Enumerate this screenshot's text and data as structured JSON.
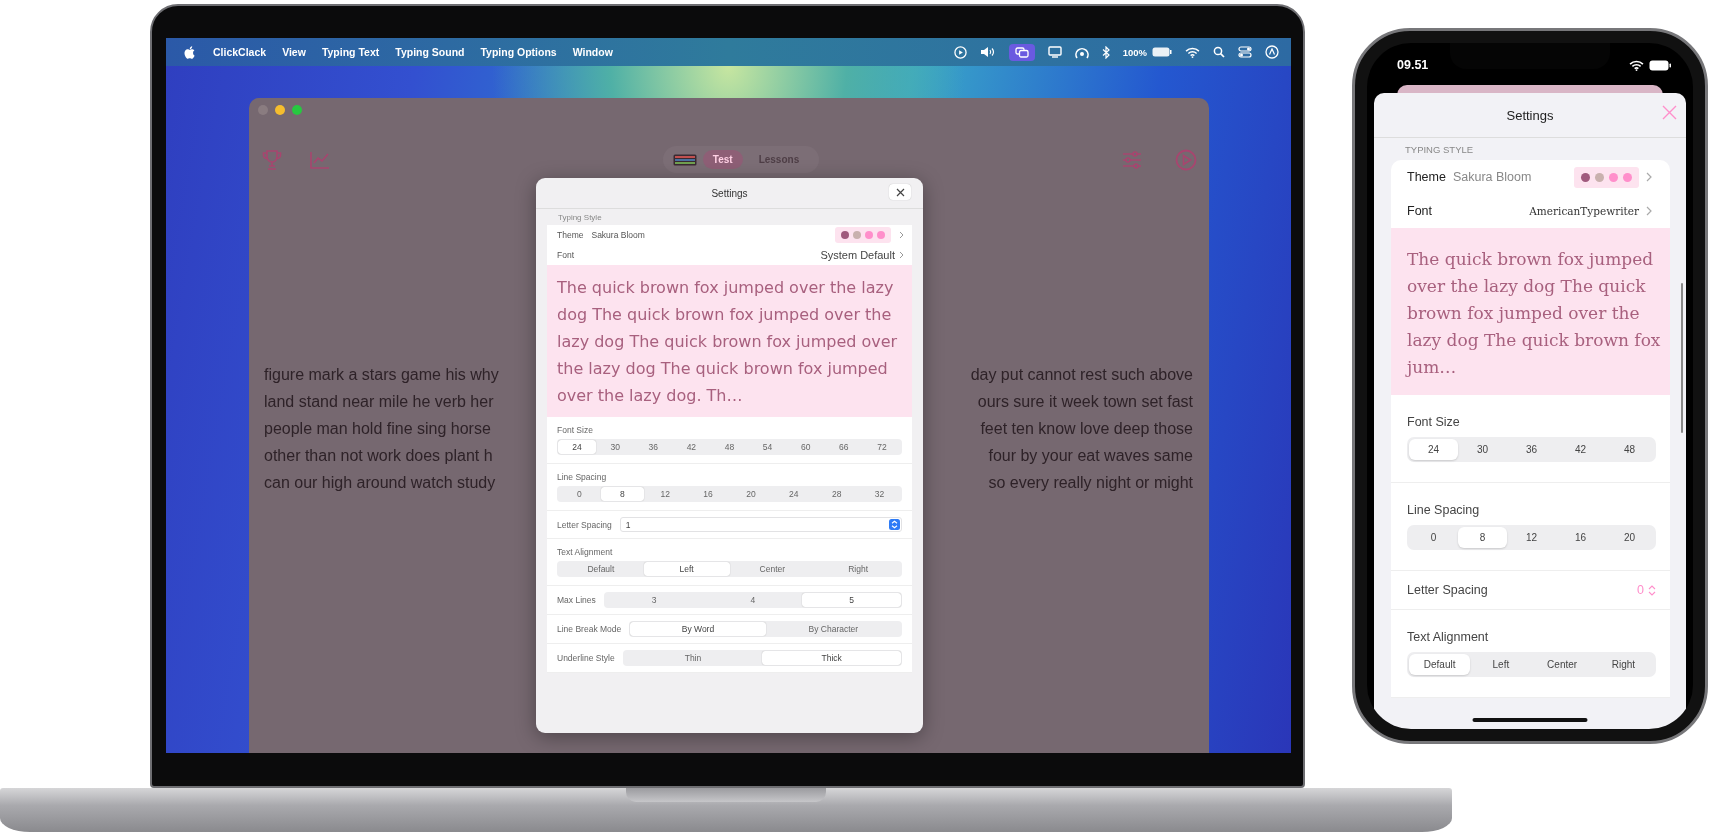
{
  "laptop": {
    "menu_bar": {
      "app_name": "ClickClack",
      "menus": [
        "View",
        "Typing Text",
        "Typing Sound",
        "Typing Options",
        "Window"
      ],
      "battery_percent": "100%"
    },
    "app_window": {
      "tabs": [
        {
          "label": "Test",
          "selected": true
        },
        {
          "label": "Lessons",
          "selected": false
        }
      ],
      "background_text": [
        {
          "left": "figure mark a stars game his why",
          "right": "day put cannot rest such above"
        },
        {
          "left": "land stand near mile he verb her",
          "right": "ours sure it week town set fast"
        },
        {
          "left": "people man hold fine sing horse",
          "right": "feet ten know love deep those"
        },
        {
          "left": "other than not work does plant h",
          "right": "four by your eat waves same"
        },
        {
          "left": "can our high around watch study",
          "right": "so every really night or might"
        }
      ]
    },
    "settings_dialog": {
      "title": "Settings",
      "section": "Typing Style",
      "theme": {
        "label": "Theme",
        "value": "Sakura Bloom",
        "swatches": [
          {
            "color": "#a05a7d"
          },
          {
            "color": "#c9b1ae"
          },
          {
            "color": "#ff8fcb"
          },
          {
            "color": "#ff8fcb"
          }
        ]
      },
      "font": {
        "label": "Font",
        "value": "System Default"
      },
      "preview": "The quick brown fox jumped over the lazy dog The quick brown fox jumped over the lazy dog The quick brown fox jumped over the lazy dog The quick brown fox jumped over the lazy dog. Th…",
      "rows": [
        {
          "kind": "stacked",
          "label": "Font Size",
          "options": [
            {
              "label": "24",
              "selected": true
            },
            {
              "label": "30",
              "selected": false
            },
            {
              "label": "36",
              "selected": false
            },
            {
              "label": "42",
              "selected": false
            },
            {
              "label": "48",
              "selected": false
            },
            {
              "label": "54",
              "selected": false
            },
            {
              "label": "60",
              "selected": false
            },
            {
              "label": "66",
              "selected": false
            },
            {
              "label": "72",
              "selected": false
            }
          ]
        },
        {
          "kind": "stacked",
          "label": "Line Spacing",
          "options": [
            {
              "label": "0",
              "selected": false
            },
            {
              "label": "8",
              "selected": true
            },
            {
              "label": "12",
              "selected": false
            },
            {
              "label": "16",
              "selected": false
            },
            {
              "label": "20",
              "selected": false
            },
            {
              "label": "24",
              "selected": false
            },
            {
              "label": "28",
              "selected": false
            },
            {
              "label": "32",
              "selected": false
            }
          ]
        },
        {
          "kind": "stepper",
          "label": "Letter Spacing",
          "value": "1"
        },
        {
          "kind": "stacked",
          "label": "Text Alignment",
          "options": [
            {
              "label": "Default",
              "selected": false
            },
            {
              "label": "Left",
              "selected": true
            },
            {
              "label": "Center",
              "selected": false
            },
            {
              "label": "Right",
              "selected": false
            }
          ]
        },
        {
          "kind": "inline",
          "label": "Max Lines",
          "options": [
            {
              "label": "3",
              "selected": false
            },
            {
              "label": "4",
              "selected": false
            },
            {
              "label": "5",
              "selected": true
            }
          ]
        },
        {
          "kind": "inline",
          "label": "Line Break Mode",
          "options": [
            {
              "label": "By Word",
              "selected": true
            },
            {
              "label": "By Character",
              "selected": false
            }
          ]
        },
        {
          "kind": "inline",
          "label": "Underline Style",
          "options": [
            {
              "label": "Thin",
              "selected": false
            },
            {
              "label": "Thick",
              "selected": true
            }
          ]
        }
      ]
    }
  },
  "phone": {
    "time": "09.51",
    "settings": {
      "title": "Settings",
      "section": "TYPING STYLE",
      "theme": {
        "label": "Theme",
        "value": "Sakura Bloom",
        "swatches": [
          {
            "color": "#a05a7d"
          },
          {
            "color": "#c9b1ae"
          },
          {
            "color": "#ff8fcb"
          },
          {
            "color": "#ff8fcb"
          }
        ]
      },
      "font": {
        "label": "Font",
        "value": "AmericanTypewriter"
      },
      "preview": "The quick brown fox jumped over the lazy dog The quick brown fox jumped over the lazy dog The quick brown fox jum…",
      "rows": [
        {
          "kind": "stacked",
          "label": "Font Size",
          "options": [
            {
              "label": "24",
              "selected": true
            },
            {
              "label": "30",
              "selected": false
            },
            {
              "label": "36",
              "selected": false
            },
            {
              "label": "42",
              "selected": false
            },
            {
              "label": "48",
              "selected": false
            }
          ]
        },
        {
          "kind": "stacked",
          "label": "Line Spacing",
          "options": [
            {
              "label": "0",
              "selected": false
            },
            {
              "label": "8",
              "selected": true
            },
            {
              "label": "12",
              "selected": false
            },
            {
              "label": "16",
              "selected": false
            },
            {
              "label": "20",
              "selected": false
            }
          ]
        },
        {
          "kind": "stepper",
          "label": "Letter Spacing",
          "value": "0"
        },
        {
          "kind": "stacked",
          "label": "Text Alignment",
          "options": [
            {
              "label": "Default",
              "selected": true
            },
            {
              "label": "Left",
              "selected": false
            },
            {
              "label": "Center",
              "selected": false
            },
            {
              "label": "Right",
              "selected": false
            }
          ]
        }
      ]
    }
  }
}
